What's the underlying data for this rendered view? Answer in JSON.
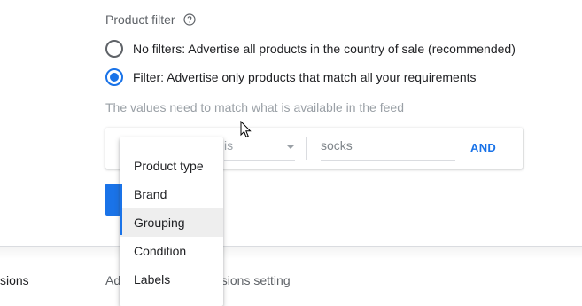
{
  "product_filter": {
    "label": "Product filter",
    "help_icon": "help-circle-icon"
  },
  "options": [
    {
      "label": "No filters: Advertise all products in the country of sale (recommended)",
      "selected": false
    },
    {
      "label": "Filter: Advertise only products that match all your requirements",
      "selected": true
    }
  ],
  "hint": "The values need to match what is available in the feed",
  "filter_row": {
    "operator": "is",
    "value": "socks",
    "and_label": "AND"
  },
  "dropdown": {
    "items": [
      {
        "label": "Product type",
        "highlighted": false
      },
      {
        "label": "Brand",
        "highlighted": false
      },
      {
        "label": "Grouping",
        "highlighted": true
      },
      {
        "label": "Condition",
        "highlighted": false
      },
      {
        "label": "Labels",
        "highlighted": false
      }
    ]
  },
  "bottom_row": {
    "left_text": "sions",
    "middle_text": "Ad",
    "middle_text_rest": "rsions setting"
  },
  "colors": {
    "accent": "#1a73e8",
    "highlight": "#eeeeee"
  }
}
